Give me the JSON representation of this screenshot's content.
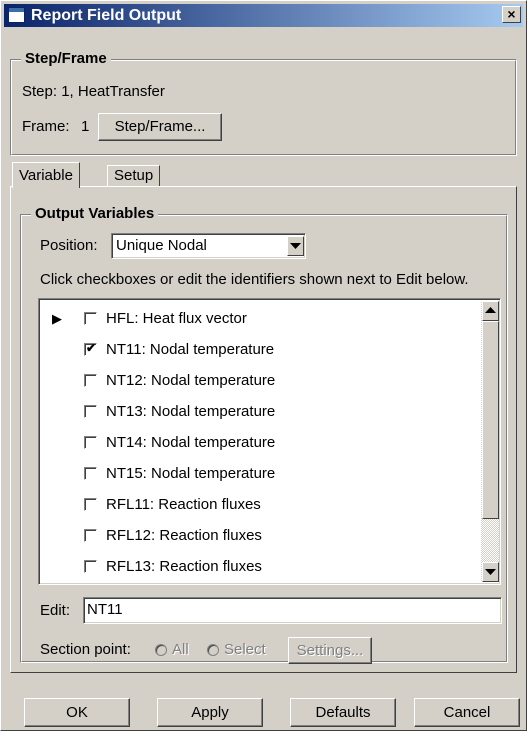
{
  "window": {
    "title": "Report Field Output",
    "close_glyph": "×"
  },
  "step_frame": {
    "group_title": "Step/Frame",
    "step_text": "Step: 1, HeatTransfer",
    "frame_label": "Frame:",
    "frame_value": "1",
    "button_label": "Step/Frame..."
  },
  "tabs": [
    {
      "label": "Variable",
      "selected": true
    },
    {
      "label": "Setup",
      "selected": false
    }
  ],
  "output_variables": {
    "group_title": "Output Variables",
    "position_label": "Position:",
    "position_value": "Unique Nodal",
    "hint": "Click checkboxes or edit the identifiers shown next to Edit below.",
    "items": [
      {
        "label": "HFL: Heat flux vector",
        "checked": false,
        "expandable": true
      },
      {
        "label": "NT11: Nodal temperature",
        "checked": true,
        "expandable": false
      },
      {
        "label": "NT12: Nodal temperature",
        "checked": false,
        "expandable": false
      },
      {
        "label": "NT13: Nodal temperature",
        "checked": false,
        "expandable": false
      },
      {
        "label": "NT14: Nodal temperature",
        "checked": false,
        "expandable": false
      },
      {
        "label": "NT15: Nodal temperature",
        "checked": false,
        "expandable": false
      },
      {
        "label": "RFL11: Reaction fluxes",
        "checked": false,
        "expandable": false
      },
      {
        "label": "RFL12: Reaction fluxes",
        "checked": false,
        "expandable": false
      },
      {
        "label": "RFL13: Reaction fluxes",
        "checked": false,
        "expandable": false
      }
    ],
    "check_glyph": "✔",
    "expand_glyph": "▶",
    "edit_label": "Edit:",
    "edit_value": "NT11",
    "section_point_label": "Section point:",
    "radio_all": "All",
    "radio_select": "Select",
    "settings_button": "Settings..."
  },
  "buttons": {
    "ok": "OK",
    "apply": "Apply",
    "defaults": "Defaults",
    "cancel": "Cancel"
  }
}
